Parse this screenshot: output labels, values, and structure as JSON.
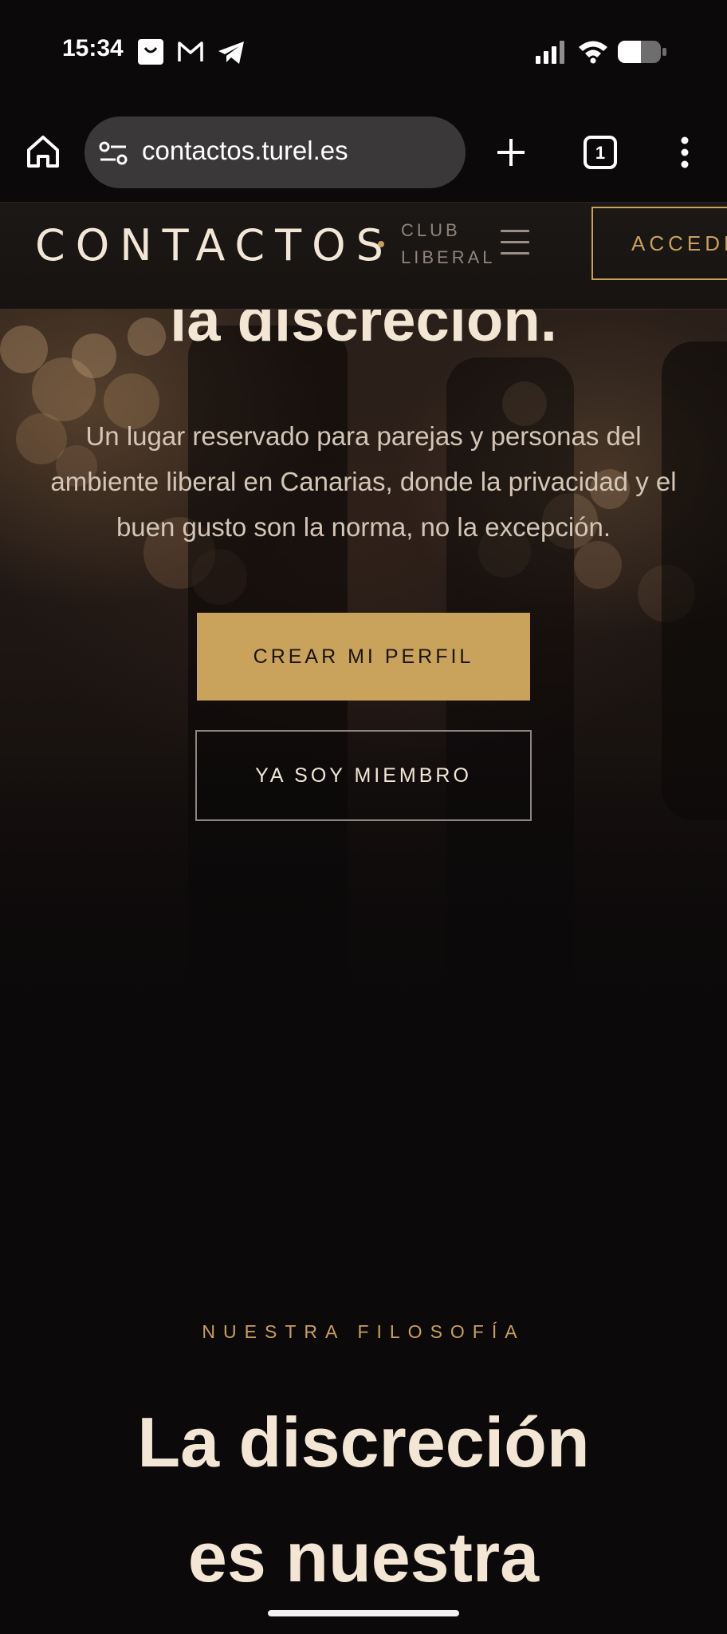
{
  "status_bar": {
    "time": "15:34",
    "notification_icons": [
      "shopping-bag-icon",
      "gmail-icon",
      "telegram-icon"
    ],
    "system_icons": [
      "signal-icon",
      "wifi-icon",
      "battery-icon"
    ]
  },
  "browser": {
    "url": "contactos.turel.es",
    "tab_count": "1"
  },
  "site_header": {
    "brand": "CONTACTOS",
    "subtitle_line1": "CLUB",
    "subtitle_line2": "LIBERAL",
    "access_label": "ACCEDER"
  },
  "hero": {
    "title": "la discreción.",
    "description": "Un lugar reservado para parejas y personas del ambiente liberal en Canarias, donde la privacidad y el buen gusto son la norma, no la excepción.",
    "primary_cta": "CREAR MI PERFIL",
    "secondary_cta": "YA SOY MIEMBRO"
  },
  "philosophy": {
    "label": "NUESTRA FILOSOFÍA",
    "title_line1": "La discreción",
    "title_line2": "es nuestra"
  },
  "colors": {
    "background": "#0c090a",
    "gold": "#c9a05a",
    "cream_text": "#f4e6d4",
    "muted_text": "#d4c6b6"
  }
}
